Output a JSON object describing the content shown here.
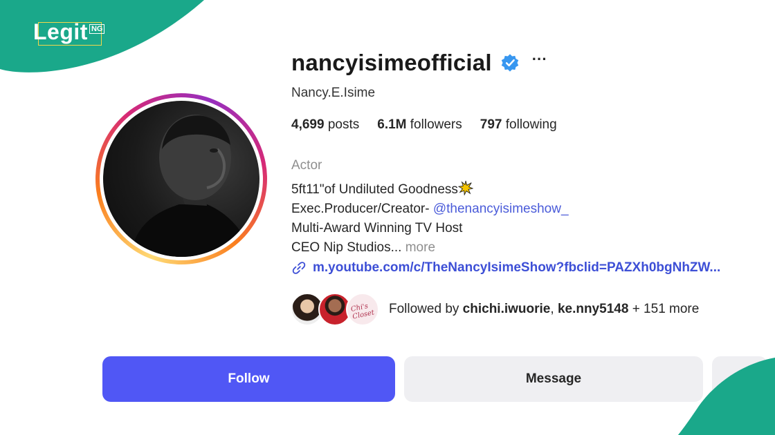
{
  "brand": {
    "logo_text": "Legit",
    "logo_suffix": "NG",
    "accent_color": "#1aa88a"
  },
  "profile": {
    "username": "nancyisimeofficial",
    "verified": true,
    "more_icon": "ellipsis-icon",
    "full_name": "Nancy.E.Isime",
    "stats": {
      "posts_count": "4,699",
      "posts_label": "posts",
      "followers_count": "6.1M",
      "followers_label": "followers",
      "following_count": "797",
      "following_label": "following"
    },
    "category": "Actor",
    "bio": {
      "line1": "5ft11\"of Undiluted Goodness",
      "line1_emoji": "collision-icon",
      "line2_prefix": "Exec.Producer/Creator- ",
      "line2_mention": "@thenancyisimeshow_",
      "line3": "Multi-Award Winning TV Host",
      "line4": "CEO Nip Studios...",
      "more_label": "more"
    },
    "link": "m.youtube.com/c/TheNancyIsimeShow?fbclid=PAZXh0bgNhZW..."
  },
  "followed_by": {
    "prefix": "Followed by",
    "user1": "chichi.iwuorie",
    "separator": ",",
    "user2": "ke.nny5148",
    "suffix": "+ 151 more",
    "avatar3_text": "Chi's Closet"
  },
  "actions": {
    "follow_label": "Follow",
    "message_label": "Message"
  },
  "colors": {
    "follow_button": "#5057f5",
    "secondary_button": "#efeff2",
    "link": "#3d4fd6",
    "verified_badge": "#3897f0"
  }
}
